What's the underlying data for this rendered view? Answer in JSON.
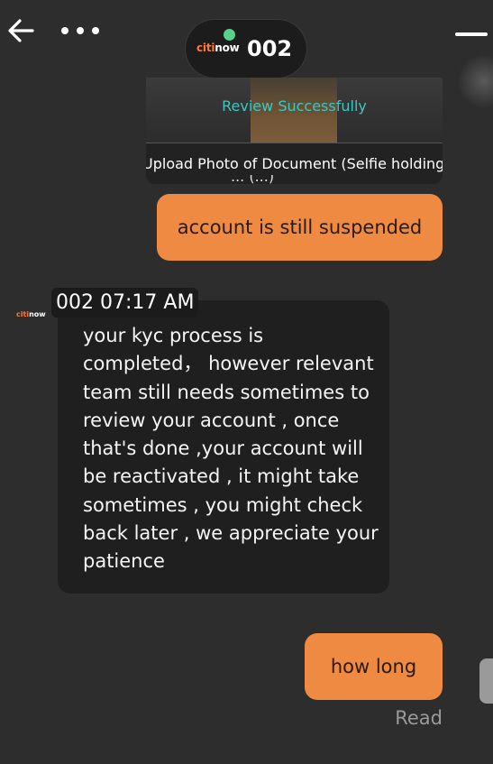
{
  "header": {
    "logo_part1": "citi",
    "logo_part2": "now",
    "chat_name": "002",
    "online_color": "#5bd08a",
    "back_icon": "arrow-left-icon",
    "more_icon": "more-horizontal-icon",
    "menu_icon": "menu-icon"
  },
  "document_card": {
    "status": "Review Successfully",
    "title": "Upload Photo of Document (Selfie holding",
    "title_cont": "... (...)"
  },
  "messages": [
    {
      "direction": "outgoing",
      "text": "account is still suspended"
    },
    {
      "direction": "incoming",
      "sender": "002",
      "time": "07:17 AM",
      "text": "your kyc process is completed， however relevant team still needs sometimes to review your account , once that's done ,your account will be reactivated , it might take sometimes , you might check back later , we appreciate your patience"
    },
    {
      "direction": "outgoing",
      "text": "how long"
    }
  ],
  "read_status": "Read",
  "colors": {
    "background": "#2d2d2d",
    "outgoing_bubble": "#ee8a41",
    "incoming_bubble": "#1f1f1f",
    "status_text": "#3ec6c0",
    "brand_orange": "#ff7a2e"
  }
}
